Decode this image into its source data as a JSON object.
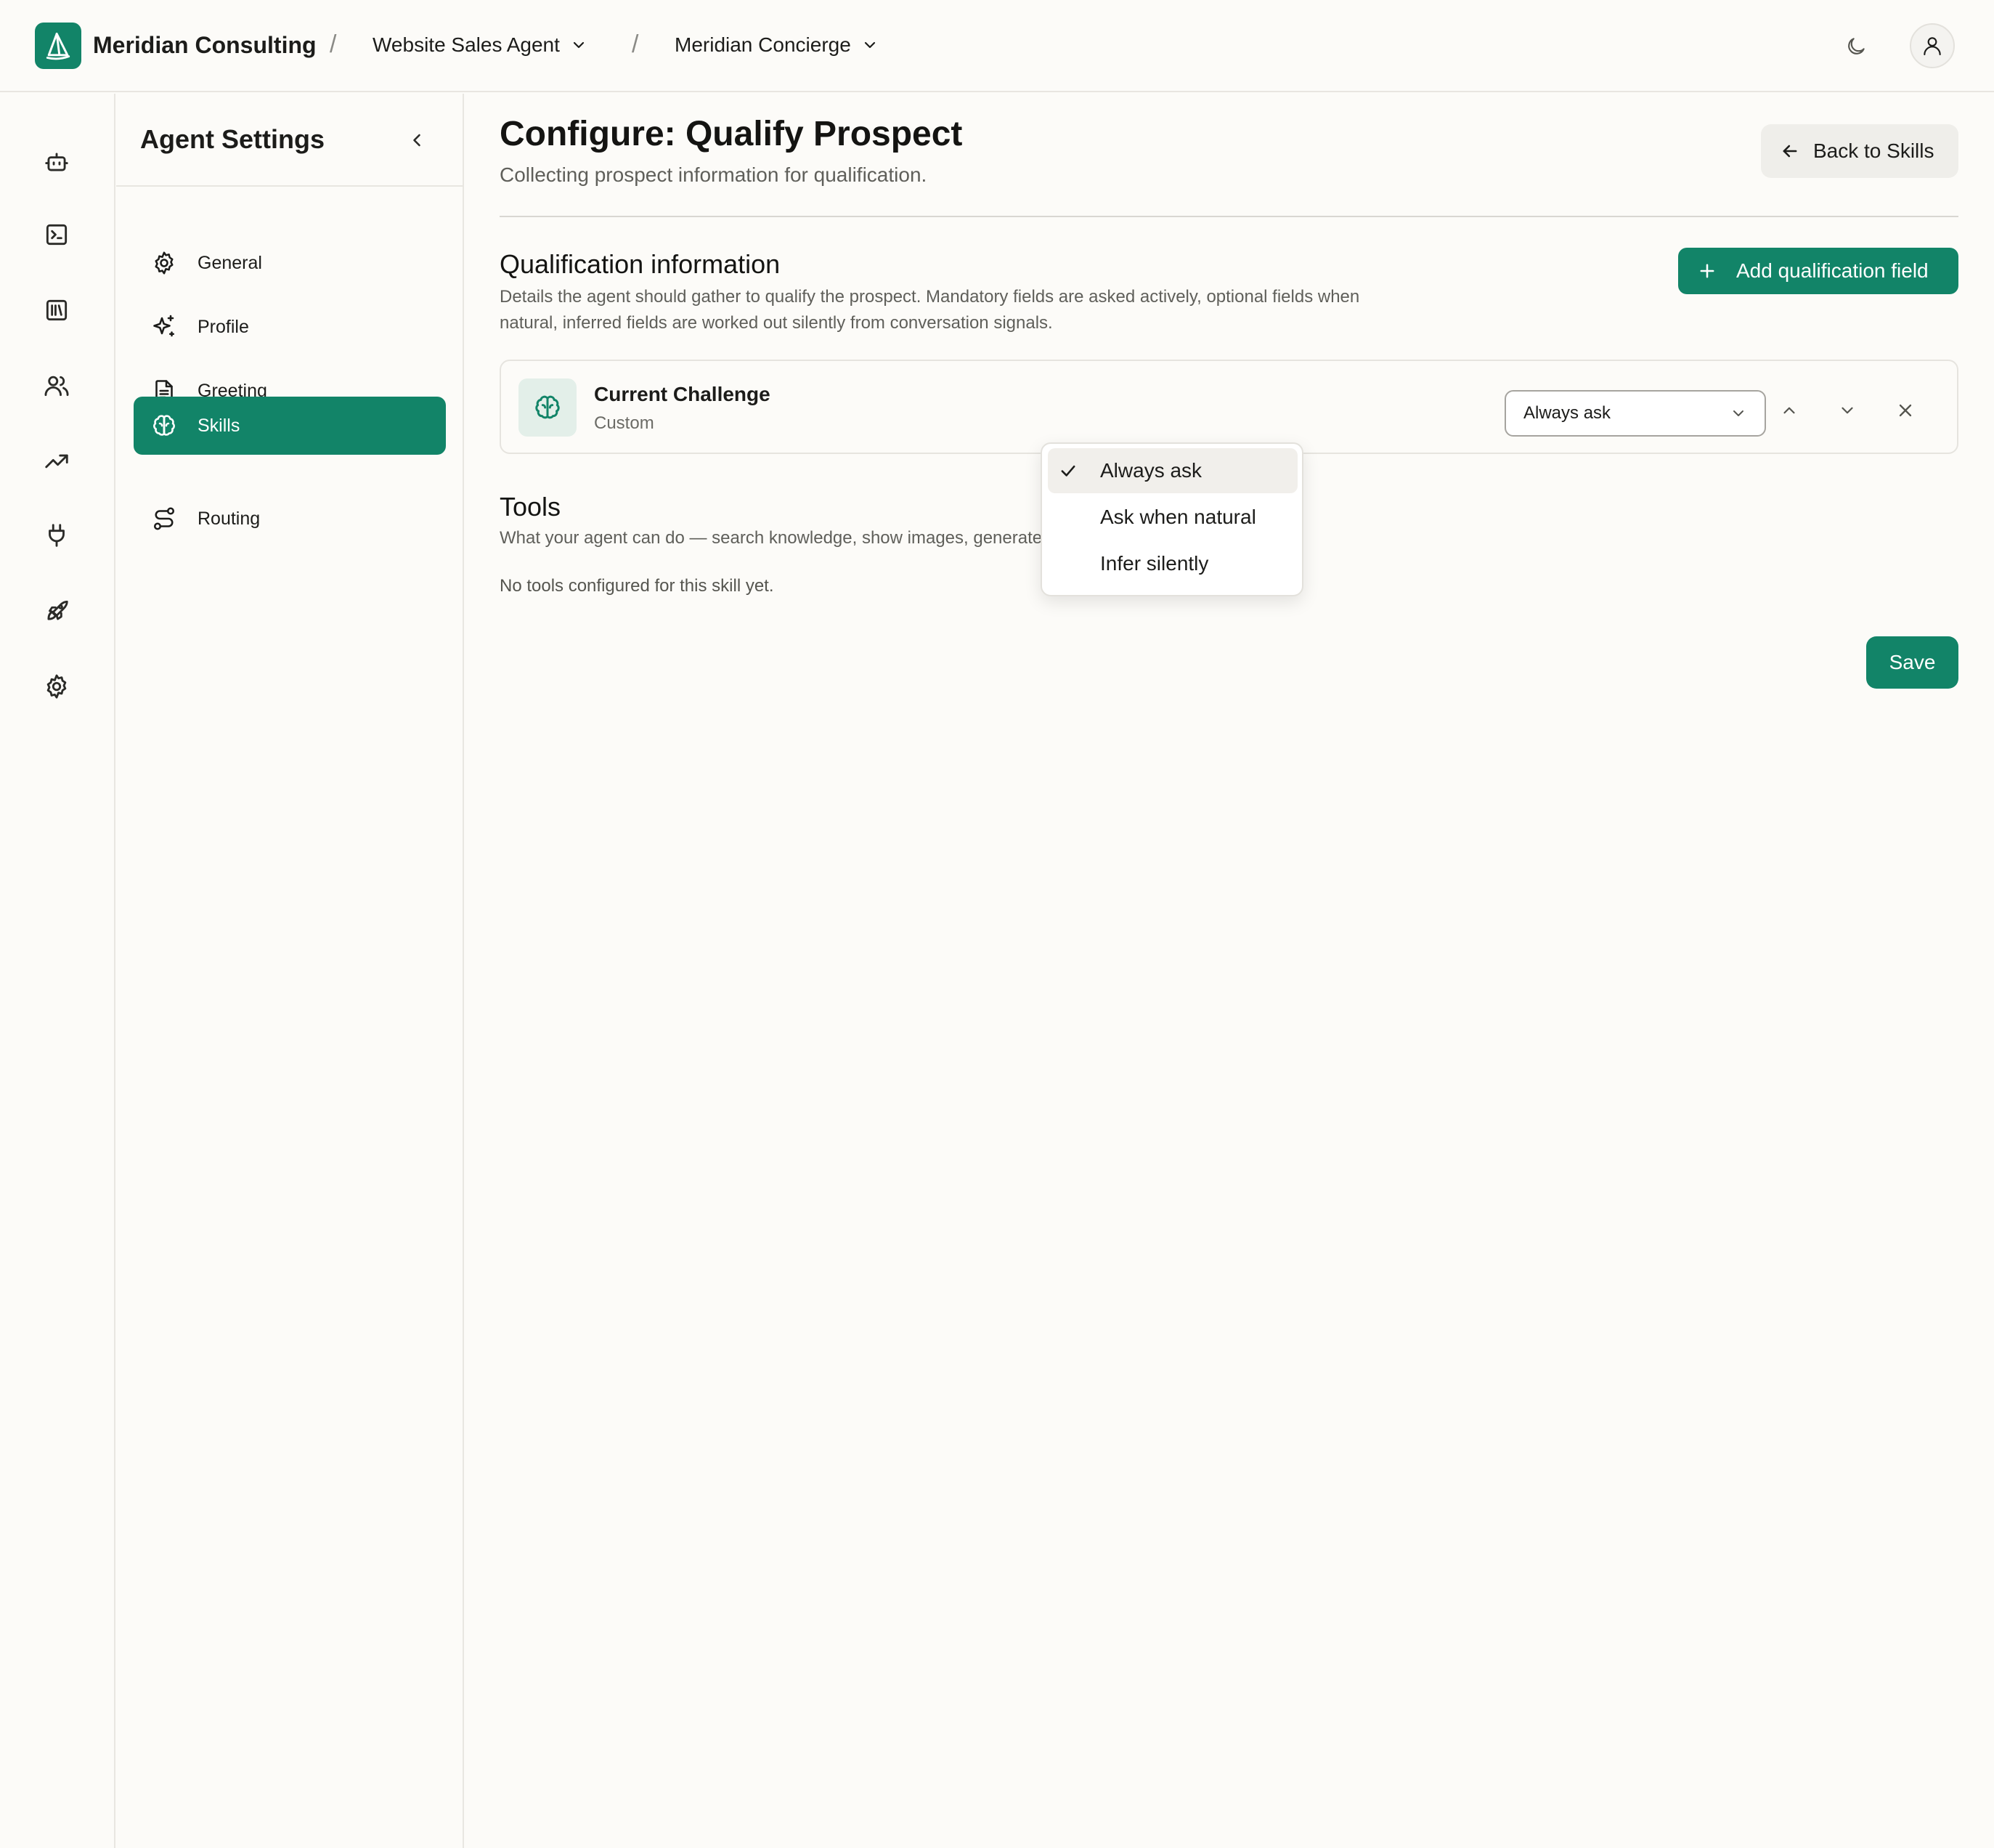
{
  "header": {
    "org_name": "Meridian Consulting",
    "separator": "/",
    "agent_selector": "Website Sales Agent",
    "concierge_selector": "Meridian Concierge",
    "theme_icon": "moon-icon",
    "user_icon": "user-icon"
  },
  "rail": {
    "items": [
      {
        "icon": "bot-icon"
      },
      {
        "icon": "terminal-icon"
      },
      {
        "icon": "library-icon"
      },
      {
        "icon": "users-icon"
      },
      {
        "icon": "trending-up-icon"
      },
      {
        "icon": "plug-icon"
      },
      {
        "icon": "rocket-icon"
      },
      {
        "icon": "gear-icon"
      }
    ]
  },
  "sidebar": {
    "title": "Agent Settings",
    "items": [
      {
        "label": "General",
        "icon": "gear-icon"
      },
      {
        "label": "Profile",
        "icon": "sparkles-icon"
      },
      {
        "label": "Greeting",
        "icon": "document-icon"
      },
      {
        "label": "Skills",
        "icon": "brain-icon",
        "active": true
      },
      {
        "label": "Routing",
        "icon": "route-icon"
      }
    ]
  },
  "main": {
    "title": "Configure: Qualify Prospect",
    "subtitle": "Collecting prospect information for qualification.",
    "back_label": "Back to Skills",
    "qualification": {
      "title": "Qualification information",
      "description_line1": "Details the agent should gather to qualify the prospect. Mandatory fields are asked actively, optional fields when",
      "description_line2": "natural, inferred fields are worked out silently from conversation signals.",
      "add_label": "Add qualification field",
      "fields": [
        {
          "name": "Current Challenge",
          "type": "Custom",
          "mode": "Always ask"
        }
      ],
      "mode_options": [
        "Always ask",
        "Ask when natural",
        "Infer silently"
      ],
      "selected_option": "Always ask"
    },
    "tools": {
      "title": "Tools",
      "description": "What your agent can do — search knowledge, show images, generate buttons, and more.",
      "empty_note": "No tools configured for this skill yet."
    },
    "save_label": "Save"
  },
  "colors": {
    "accent": "#128468",
    "background": "#fcfbf8",
    "border": "#e8e6e1"
  }
}
